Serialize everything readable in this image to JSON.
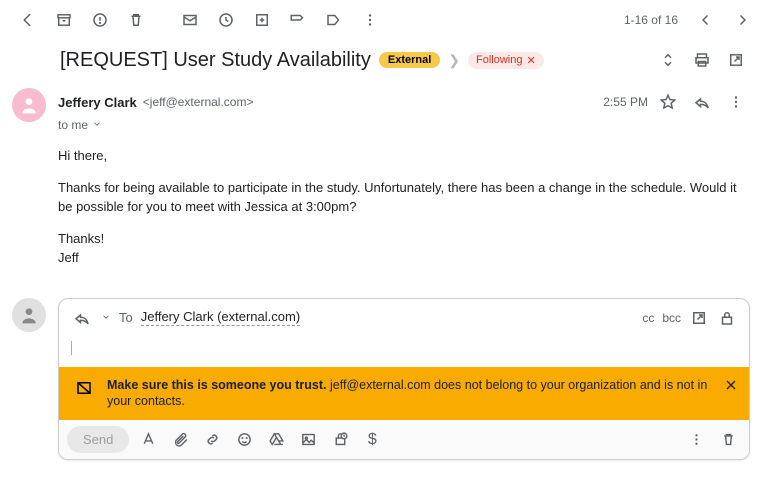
{
  "pagination": "1-16 of 16",
  "subject": "[REQUEST] User Study Availability",
  "external_label": "External",
  "following_label": "Following",
  "sender": {
    "name": "Jeffery Clark",
    "email": "<jeff@external.com>"
  },
  "to_me": "to me",
  "timestamp": "2:55 PM",
  "body": {
    "greeting": "Hi there,",
    "para": "Thanks for being available to participate in the study. Unfortunately, there has been a change in the schedule. Would it be possible for you to meet with Jessica at 3:00pm?",
    "thanks": "Thanks!",
    "sig": "Jeff"
  },
  "compose": {
    "to_label": "To",
    "recipient": "Jeffery Clark (external.com)",
    "cc": "cc",
    "bcc": "bcc",
    "send_label": "Send"
  },
  "warning": {
    "bold": "Make sure this is someone you trust.",
    "rest": " jeff@external.com does not belong to your organization and is not in your contacts."
  }
}
